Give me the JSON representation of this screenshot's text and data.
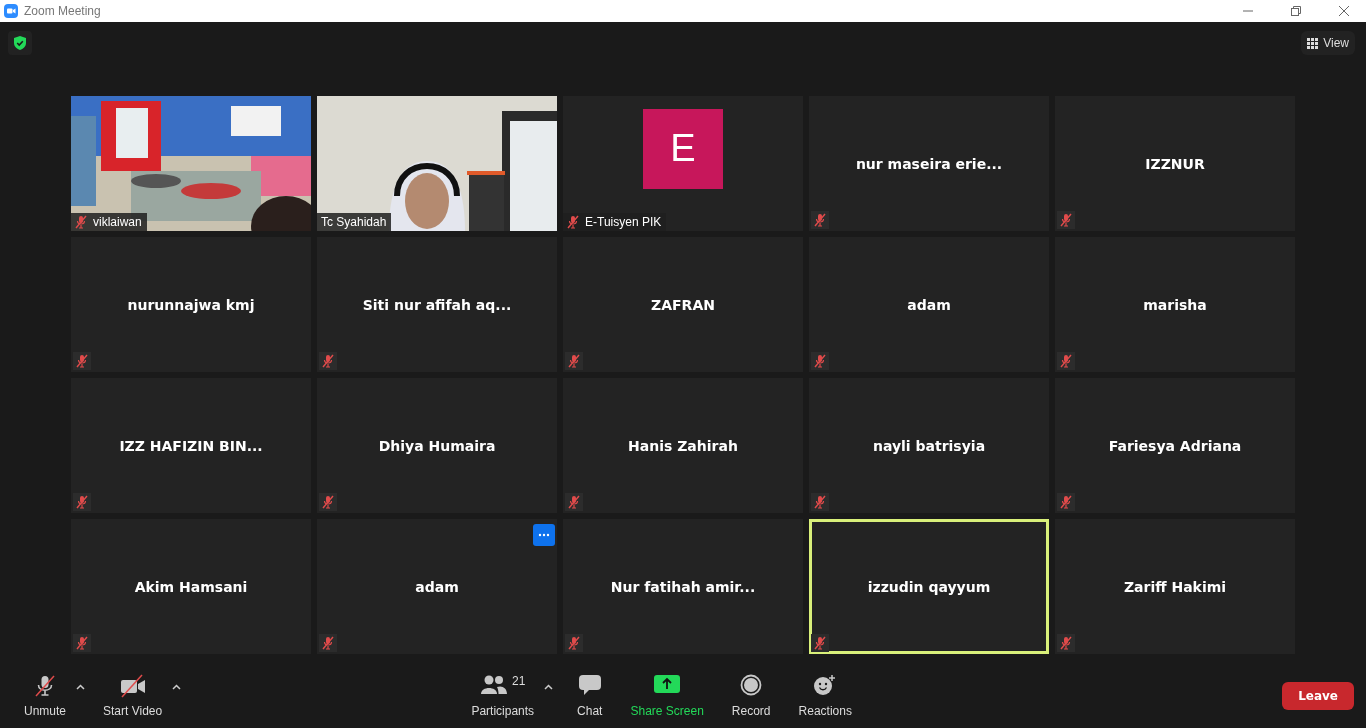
{
  "window": {
    "title": "Zoom Meeting"
  },
  "view_button": {
    "label": "View"
  },
  "tiles": [
    {
      "kind": "video",
      "name": "viklaiwan",
      "muted": true,
      "speaking": false,
      "menu": false
    },
    {
      "kind": "video",
      "name": "Tc Syahidah",
      "muted": false,
      "speaking": false,
      "menu": false
    },
    {
      "kind": "avatar",
      "initial": "E",
      "name": "E-Tuisyen PIK",
      "muted": true,
      "speaking": false,
      "menu": false
    },
    {
      "kind": "name",
      "name": "nur maseira erie...",
      "muted": true,
      "speaking": false,
      "menu": false
    },
    {
      "kind": "name",
      "name": "IZZNUR",
      "muted": true,
      "speaking": false,
      "menu": false
    },
    {
      "kind": "name",
      "name": "nurunnajwa kmj",
      "muted": true,
      "speaking": false,
      "menu": false
    },
    {
      "kind": "name",
      "name": "Siti nur afifah aq...",
      "muted": true,
      "speaking": false,
      "menu": false
    },
    {
      "kind": "name",
      "name": "ZAFRAN",
      "muted": true,
      "speaking": false,
      "menu": false
    },
    {
      "kind": "name",
      "name": "adam",
      "muted": true,
      "speaking": false,
      "menu": false
    },
    {
      "kind": "name",
      "name": "marisha",
      "muted": true,
      "speaking": false,
      "menu": false
    },
    {
      "kind": "name",
      "name": "IZZ HAFIZIN BIN...",
      "muted": true,
      "speaking": false,
      "menu": false
    },
    {
      "kind": "name",
      "name": "Dhiya Humaira",
      "muted": true,
      "speaking": false,
      "menu": false
    },
    {
      "kind": "name",
      "name": "Hanis Zahirah",
      "muted": true,
      "speaking": false,
      "menu": false
    },
    {
      "kind": "name",
      "name": "nayli batrisyia",
      "muted": true,
      "speaking": false,
      "menu": false
    },
    {
      "kind": "name",
      "name": "Fariesya Adriana",
      "muted": true,
      "speaking": false,
      "menu": false
    },
    {
      "kind": "name",
      "name": "Akim Hamsani",
      "muted": true,
      "speaking": false,
      "menu": false
    },
    {
      "kind": "name",
      "name": "adam",
      "muted": true,
      "speaking": false,
      "menu": true
    },
    {
      "kind": "name",
      "name": "Nur fatihah amir...",
      "muted": true,
      "speaking": false,
      "menu": false
    },
    {
      "kind": "name",
      "name": "izzudin qayyum",
      "muted": true,
      "speaking": true,
      "menu": false
    },
    {
      "kind": "name",
      "name": "Zariff Hakimi",
      "muted": true,
      "speaking": false,
      "menu": false
    }
  ],
  "toolbar": {
    "left": [
      {
        "label": "Unmute",
        "has_menu": true
      },
      {
        "label": "Start Video",
        "has_menu": true
      }
    ],
    "center": [
      {
        "label": "Participants",
        "count": "21",
        "has_menu": true,
        "highlighted": false
      },
      {
        "label": "Chat",
        "has_menu": false,
        "highlighted": false
      },
      {
        "label": "Share Screen",
        "has_menu": false,
        "highlighted": true
      },
      {
        "label": "Record",
        "has_menu": false,
        "highlighted": false
      },
      {
        "label": "Reactions",
        "has_menu": false,
        "highlighted": false
      }
    ],
    "leave_button": "Leave"
  }
}
